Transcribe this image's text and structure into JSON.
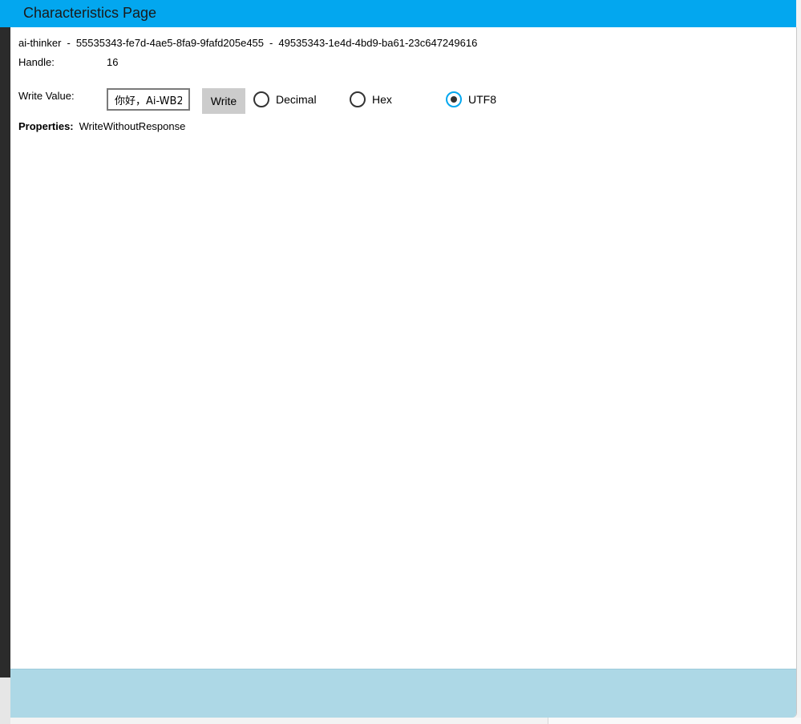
{
  "window": {
    "title": "Characteristics Page"
  },
  "device": {
    "name": "ai-thinker",
    "separator": "-",
    "service_uuid": "55535343-fe7d-4ae5-8fa9-9fafd205e455",
    "characteristic_uuid": "49535343-1e4d-4bd9-ba61-23c647249616"
  },
  "handle": {
    "label": "Handle:",
    "value": "16"
  },
  "write": {
    "label": "Write Value:",
    "input_value": "你好，Ai-WB2",
    "button_label": "Write",
    "formats": [
      {
        "label": "Decimal",
        "checked": false
      },
      {
        "label": "Hex",
        "checked": false
      },
      {
        "label": "UTF8",
        "checked": true
      }
    ]
  },
  "properties": {
    "label": "Properties:",
    "value": "WriteWithoutResponse"
  },
  "colors": {
    "titlebar": "#03a7ef",
    "bottom_bar": "#add8e6",
    "radio_accent": "#03a7ef"
  }
}
